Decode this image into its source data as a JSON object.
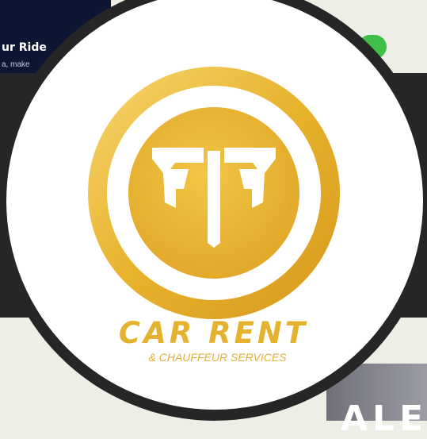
{
  "background_page": {
    "banner_title": "ur Ride",
    "banner_subtitle": "a, make"
  },
  "logo": {
    "brand_name": "CAR RENT",
    "tagline": "& CHAUFFEUR SERVICES",
    "icon": "ff-monogram-shield-icon"
  },
  "colors": {
    "gold": "#e4b22f",
    "gold_light": "#f6d36b",
    "dark_ring": "#262626",
    "navy": "#0d1733",
    "toggle_green": "#3fbf4a"
  }
}
